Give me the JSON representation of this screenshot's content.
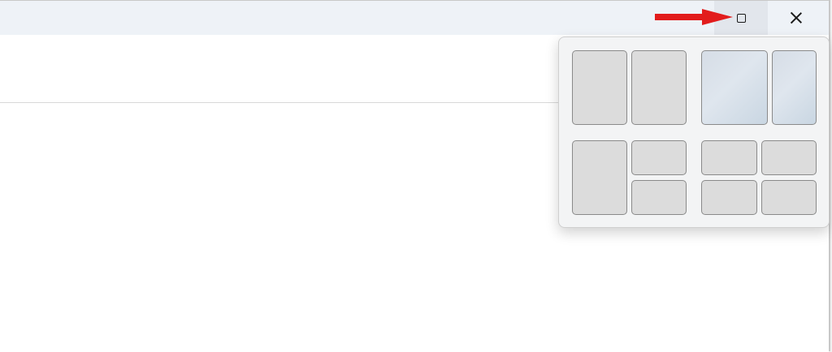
{
  "window": {
    "titlebar": {
      "maximize_icon": "maximize-square-icon",
      "close_icon": "close-x-icon"
    }
  },
  "annotation": {
    "arrow_color": "#e21c1c",
    "arrow_icon": "red-arrow-icon"
  },
  "snap_layouts": {
    "layouts": [
      {
        "name": "two-columns-equal",
        "zones": 2
      },
      {
        "name": "two-columns-wide-narrow",
        "zones": 2,
        "highlighted": true
      },
      {
        "name": "three-zones-left-column-right-split",
        "zones": 3
      },
      {
        "name": "four-quadrants",
        "zones": 4
      }
    ]
  }
}
